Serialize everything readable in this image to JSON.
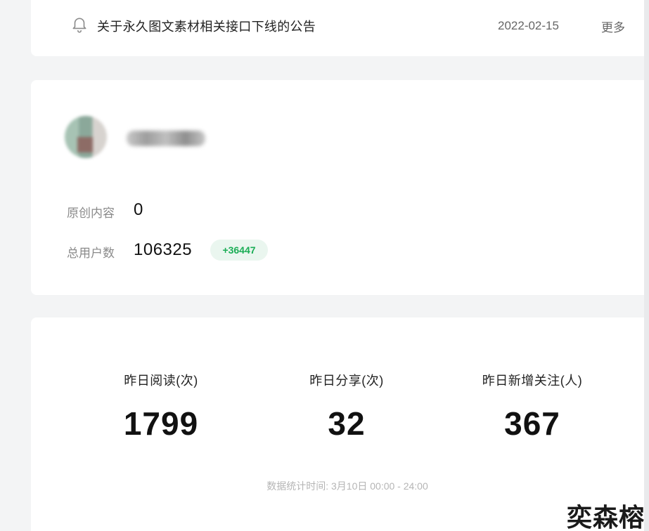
{
  "notice": {
    "title": "关于永久图文素材相关接口下线的公告",
    "date": "2022-02-15",
    "more_label": "更多",
    "icon": "bell-icon"
  },
  "account": {
    "stats": [
      {
        "label": "原创内容",
        "value": "0"
      },
      {
        "label": "总用户数",
        "value": "106325",
        "growth": "+36447"
      }
    ]
  },
  "yesterday": {
    "metrics": [
      {
        "label": "昨日阅读(次)",
        "value": "1799"
      },
      {
        "label": "昨日分享(次)",
        "value": "32"
      },
      {
        "label": "昨日新增关注(人)",
        "value": "367"
      }
    ],
    "footnote": "数据统计时间: 3月10日 00:00 - 24:00"
  },
  "watermark": "奕森榕",
  "colors": {
    "background": "#f3f4f5",
    "card": "#ffffff",
    "growth_text": "#1aad55",
    "growth_bg": "#eaf6ef"
  }
}
